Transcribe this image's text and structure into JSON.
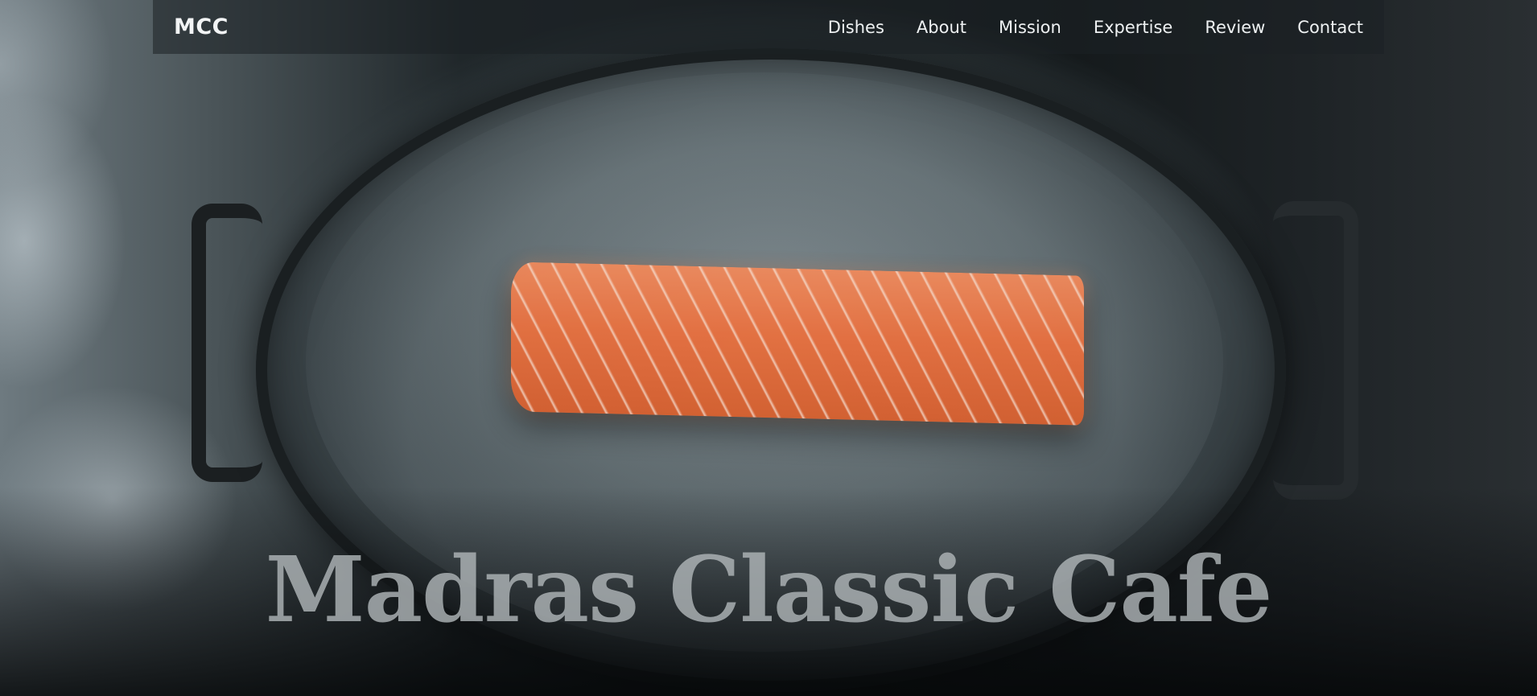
{
  "navbar": {
    "brand": "MCC",
    "links": [
      {
        "label": "Dishes"
      },
      {
        "label": "About"
      },
      {
        "label": "Mission"
      },
      {
        "label": "Expertise"
      },
      {
        "label": "Review"
      },
      {
        "label": "Contact"
      }
    ]
  },
  "hero": {
    "title": "Madras Classic Cafe",
    "image": "salmon-fillet-on-smoking-pan"
  },
  "colors": {
    "nav_text": "#eef1f2",
    "title_text": "#afb4b7",
    "background_dark": "#0e1214",
    "salmon": "#e8703f"
  }
}
